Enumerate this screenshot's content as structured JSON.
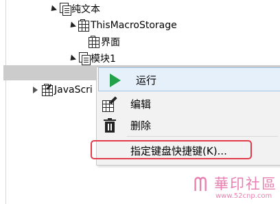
{
  "tree": {
    "items": [
      {
        "label": "纯文本"
      },
      {
        "label": "ThisMacroStorage"
      },
      {
        "label": "界面"
      },
      {
        "label": "模块1"
      },
      {
        "label": "JavaScri"
      }
    ]
  },
  "context_menu": {
    "items": [
      {
        "label": "运行",
        "icon": "play-icon"
      },
      {
        "label": "编辑",
        "icon": "edit-icon"
      },
      {
        "label": "删除",
        "icon": "trash-icon"
      },
      {
        "label": "指定键盘快捷键(K)..."
      }
    ]
  },
  "watermark": {
    "brand": "華印社區",
    "url": "www.52cnp.com"
  },
  "colors": {
    "accent_red": "#e23a4a",
    "run_green": "#22a04a",
    "watermark_pink": "#e97fb0"
  }
}
